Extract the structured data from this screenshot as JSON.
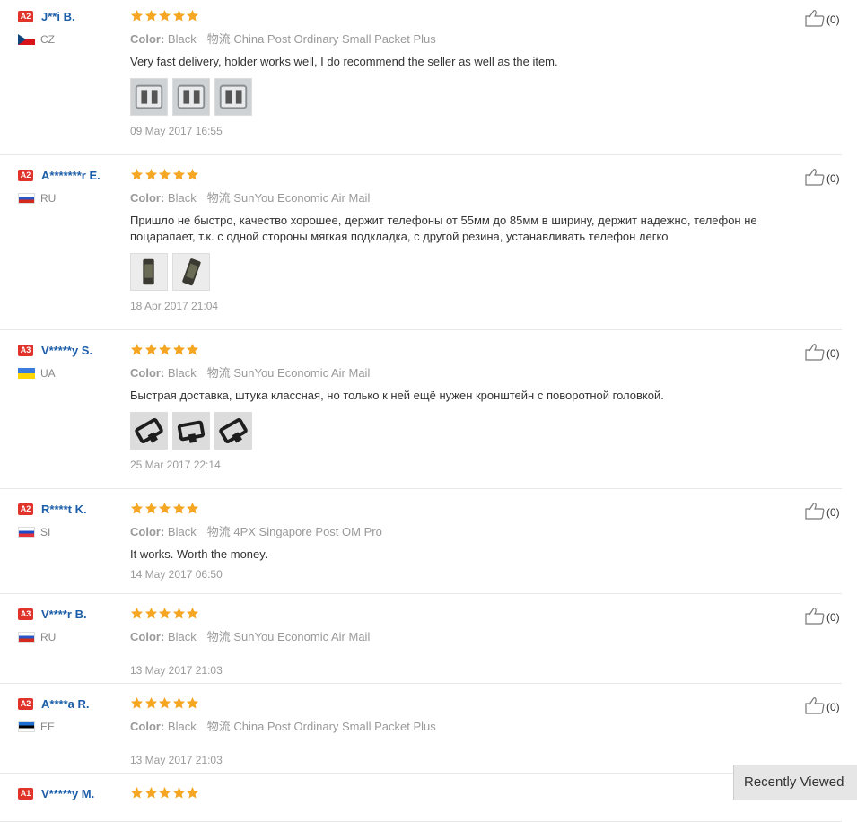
{
  "labels": {
    "color": "Color:",
    "logistics": "物流"
  },
  "reviews": [
    {
      "level": "A2",
      "name": "J**i B.",
      "country": "CZ",
      "color": "Black",
      "shipping": "China Post Ordinary Small Packet Plus",
      "text": "Very fast delivery, holder works well, I do recommend the seller as well as the item.",
      "photos": 3,
      "date": "09 May 2017 16:55",
      "helpful": "(0)",
      "stars": 5
    },
    {
      "level": "A2",
      "name": "A*******r E.",
      "country": "RU",
      "color": "Black",
      "shipping": "SunYou Economic Air Mail",
      "text": "Пришло не быстро, качество хорошее, держит телефоны от 55мм до 85мм в ширину, держит надежно, телефон не поцарапает, т.к. с одной стороны мягкая подкладка, с другой резина, устанавливать телефон легко",
      "photos": 2,
      "date": "18 Apr 2017 21:04",
      "helpful": "(0)",
      "stars": 5
    },
    {
      "level": "A3",
      "name": "V*****y S.",
      "country": "UA",
      "color": "Black",
      "shipping": "SunYou Economic Air Mail",
      "text": "Быстрая доставка, штука классная, но только к ней ещё нужен кронштейн с поворотной головкой.",
      "photos": 3,
      "date": "25 Mar 2017 22:14",
      "helpful": "(0)",
      "stars": 5
    },
    {
      "level": "A2",
      "name": "R****t K.",
      "country": "SI",
      "color": "Black",
      "shipping": "4PX Singapore Post OM Pro",
      "text": "It works. Worth the money.",
      "photos": 0,
      "date": "14 May 2017 06:50",
      "helpful": "(0)",
      "stars": 5
    },
    {
      "level": "A3",
      "name": "V****r B.",
      "country": "RU",
      "color": "Black",
      "shipping": "SunYou Economic Air Mail",
      "text": "",
      "photos": 0,
      "date": "13 May 2017 21:03",
      "helpful": "(0)",
      "stars": 5
    },
    {
      "level": "A2",
      "name": "A****a R.",
      "country": "EE",
      "color": "Black",
      "shipping": "China Post Ordinary Small Packet Plus",
      "text": "",
      "photos": 0,
      "date": "13 May 2017 21:03",
      "helpful": "(0)",
      "stars": 5
    },
    {
      "level": "A1",
      "name": "V*****y M.",
      "country": "",
      "color": "",
      "shipping": "",
      "text": "",
      "photos": 0,
      "date": "",
      "helpful": "",
      "stars": 5
    }
  ],
  "recently_viewed": "Recently Viewed",
  "colors": {
    "star": "#f5a623",
    "name": "#1d5ea8",
    "badge": "#e0332a"
  }
}
